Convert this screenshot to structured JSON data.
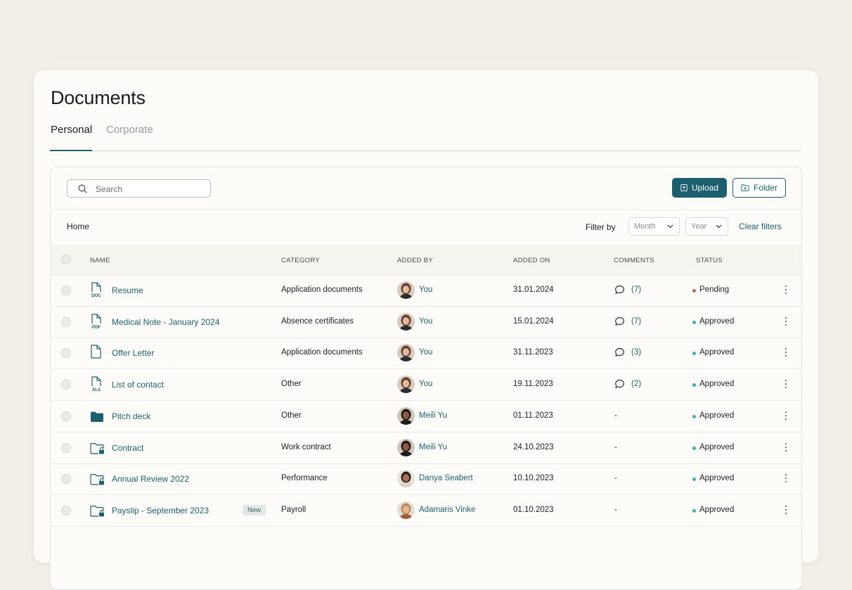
{
  "page": {
    "title": "Documents"
  },
  "tabs": [
    {
      "label": "Personal",
      "active": true
    },
    {
      "label": "Corporate",
      "active": false
    }
  ],
  "toolbar": {
    "search_placeholder": "Search",
    "upload_label": "Upload",
    "folder_label": "Folder"
  },
  "filters": {
    "breadcrumb": "Home",
    "filter_label": "Filter by",
    "month": "Month",
    "year": "Year",
    "clear_label": "Clear filters"
  },
  "columns": {
    "name": "NAME",
    "category": "CATEGORY",
    "added_by": "ADDED BY",
    "added_on": "ADDED ON",
    "comments": "COMMENTS",
    "status": "STATUS"
  },
  "colors": {
    "accent": "#1c5f6e",
    "approved": "#2fb7a8",
    "pending": "#c46a4a"
  },
  "rows": [
    {
      "icon": "doc-file-icon",
      "name": "Resume",
      "badge": "",
      "category": "Application documents",
      "user": "You",
      "avatar": "avatar-you",
      "date": "31.01.2024",
      "comments": "(7)",
      "status": "Pending"
    },
    {
      "icon": "pdf-file-icon",
      "name": "Medical Note - January 2024",
      "badge": "",
      "category": "Absence certificates",
      "user": "You",
      "avatar": "avatar-you",
      "date": "15.01.2024",
      "comments": "(7)",
      "status": "Approved"
    },
    {
      "icon": "blank-file-icon",
      "name": "Offer Letter",
      "badge": "",
      "category": "Application documents",
      "user": "You",
      "avatar": "avatar-you",
      "date": "31.11.2023",
      "comments": "(3)",
      "status": "Approved"
    },
    {
      "icon": "xls-file-icon",
      "name": "List of contact",
      "badge": "",
      "category": "Other",
      "user": "You",
      "avatar": "avatar-you",
      "date": "19.11.2023",
      "comments": "(2)",
      "status": "Approved"
    },
    {
      "icon": "folder-icon",
      "name": "Pitch deck",
      "badge": "",
      "category": "Other",
      "user": "Meili Yu",
      "avatar": "avatar-meili",
      "date": "01.11.2023",
      "comments": "-",
      "status": "Approved"
    },
    {
      "icon": "locked-folder-icon",
      "name": "Contract",
      "badge": "",
      "category": "Work contract",
      "user": "Meili Yu",
      "avatar": "avatar-meili",
      "date": "24.10.2023",
      "comments": "-",
      "status": "Approved"
    },
    {
      "icon": "locked-folder-icon",
      "name": "Annual Review 2022",
      "badge": "",
      "category": "Performance",
      "user": "Danya Seabert",
      "avatar": "avatar-danya",
      "date": "10.10.2023",
      "comments": "-",
      "status": "Approved"
    },
    {
      "icon": "locked-folder-icon",
      "name": "Payslip - September 2023",
      "badge": "New",
      "category": "Payroll",
      "user": "Adamaris Vinke",
      "avatar": "avatar-adamaris",
      "date": "01.10.2023",
      "comments": "-",
      "status": "Approved"
    }
  ]
}
